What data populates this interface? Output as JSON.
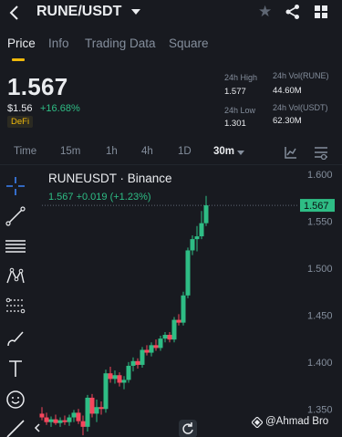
{
  "header": {
    "pair": "RUNE/USDT"
  },
  "tabs": [
    {
      "label": "Price",
      "active": true
    },
    {
      "label": "Info",
      "active": false
    },
    {
      "label": "Trading Data",
      "active": false
    },
    {
      "label": "Square",
      "active": false
    }
  ],
  "ticker": {
    "last_price": "1.567",
    "fiat_price": "$1.56",
    "change_pct": "+16.68%",
    "tag": "DeFi",
    "high_label": "24h High",
    "high_value": "1.577",
    "low_label": "24h Low",
    "low_value": "1.301",
    "vol_base_label": "24h Vol(RUNE)",
    "vol_base_value": "44.60M",
    "vol_quote_label": "24h Vol(USDT)",
    "vol_quote_value": "62.30M"
  },
  "intervals": [
    {
      "label": "Time",
      "active": false
    },
    {
      "label": "15m",
      "active": false
    },
    {
      "label": "1h",
      "active": false
    },
    {
      "label": "4h",
      "active": false
    },
    {
      "label": "1D",
      "active": false
    },
    {
      "label": "30m",
      "active": true
    }
  ],
  "chart_header": {
    "title": "RUNEUSDT · Binance",
    "price_line": "1.567  +0.019 (+1.23%)"
  },
  "watermark": "@Ahmad Bro",
  "colors": {
    "up": "#2ebd85",
    "down": "#f6465d",
    "accent": "#f0b90b",
    "background": "#181a20"
  },
  "chart_data": {
    "type": "candlestick",
    "y_ticks": [
      "1.600",
      "1.550",
      "1.500",
      "1.450",
      "1.400",
      "1.350"
    ],
    "ylim": [
      1.325,
      1.605
    ],
    "current_price_label": "1.567",
    "current_price": 1.567,
    "candles": [
      {
        "o": 1.345,
        "h": 1.352,
        "l": 1.338,
        "c": 1.341
      },
      {
        "o": 1.341,
        "h": 1.346,
        "l": 1.333,
        "c": 1.336
      },
      {
        "o": 1.336,
        "h": 1.342,
        "l": 1.331,
        "c": 1.339
      },
      {
        "o": 1.339,
        "h": 1.344,
        "l": 1.333,
        "c": 1.335
      },
      {
        "o": 1.335,
        "h": 1.341,
        "l": 1.331,
        "c": 1.338
      },
      {
        "o": 1.338,
        "h": 1.343,
        "l": 1.333,
        "c": 1.336
      },
      {
        "o": 1.336,
        "h": 1.344,
        "l": 1.332,
        "c": 1.341
      },
      {
        "o": 1.341,
        "h": 1.349,
        "l": 1.336,
        "c": 1.346
      },
      {
        "o": 1.346,
        "h": 1.35,
        "l": 1.334,
        "c": 1.337
      },
      {
        "o": 1.337,
        "h": 1.343,
        "l": 1.322,
        "c": 1.331
      },
      {
        "o": 1.331,
        "h": 1.365,
        "l": 1.326,
        "c": 1.362
      },
      {
        "o": 1.362,
        "h": 1.366,
        "l": 1.341,
        "c": 1.345
      },
      {
        "o": 1.345,
        "h": 1.36,
        "l": 1.336,
        "c": 1.352
      },
      {
        "o": 1.352,
        "h": 1.358,
        "l": 1.344,
        "c": 1.35
      },
      {
        "o": 1.35,
        "h": 1.392,
        "l": 1.346,
        "c": 1.388
      },
      {
        "o": 1.388,
        "h": 1.395,
        "l": 1.378,
        "c": 1.382
      },
      {
        "o": 1.382,
        "h": 1.391,
        "l": 1.377,
        "c": 1.386
      },
      {
        "o": 1.386,
        "h": 1.389,
        "l": 1.374,
        "c": 1.378
      },
      {
        "o": 1.378,
        "h": 1.385,
        "l": 1.371,
        "c": 1.381
      },
      {
        "o": 1.381,
        "h": 1.4,
        "l": 1.378,
        "c": 1.396
      },
      {
        "o": 1.396,
        "h": 1.405,
        "l": 1.39,
        "c": 1.401
      },
      {
        "o": 1.401,
        "h": 1.404,
        "l": 1.393,
        "c": 1.397
      },
      {
        "o": 1.397,
        "h": 1.416,
        "l": 1.394,
        "c": 1.413
      },
      {
        "o": 1.413,
        "h": 1.418,
        "l": 1.407,
        "c": 1.41
      },
      {
        "o": 1.41,
        "h": 1.421,
        "l": 1.406,
        "c": 1.418
      },
      {
        "o": 1.418,
        "h": 1.424,
        "l": 1.412,
        "c": 1.415
      },
      {
        "o": 1.415,
        "h": 1.428,
        "l": 1.412,
        "c": 1.425
      },
      {
        "o": 1.425,
        "h": 1.432,
        "l": 1.421,
        "c": 1.429
      },
      {
        "o": 1.429,
        "h": 1.432,
        "l": 1.421,
        "c": 1.424
      },
      {
        "o": 1.424,
        "h": 1.448,
        "l": 1.421,
        "c": 1.445
      },
      {
        "o": 1.445,
        "h": 1.451,
        "l": 1.439,
        "c": 1.442
      },
      {
        "o": 1.442,
        "h": 1.475,
        "l": 1.439,
        "c": 1.471
      },
      {
        "o": 1.471,
        "h": 1.522,
        "l": 1.468,
        "c": 1.519
      },
      {
        "o": 1.519,
        "h": 1.535,
        "l": 1.514,
        "c": 1.531
      },
      {
        "o": 1.531,
        "h": 1.545,
        "l": 1.518,
        "c": 1.534
      },
      {
        "o": 1.534,
        "h": 1.561,
        "l": 1.531,
        "c": 1.548
      },
      {
        "o": 1.548,
        "h": 1.577,
        "l": 1.545,
        "c": 1.567
      }
    ]
  }
}
